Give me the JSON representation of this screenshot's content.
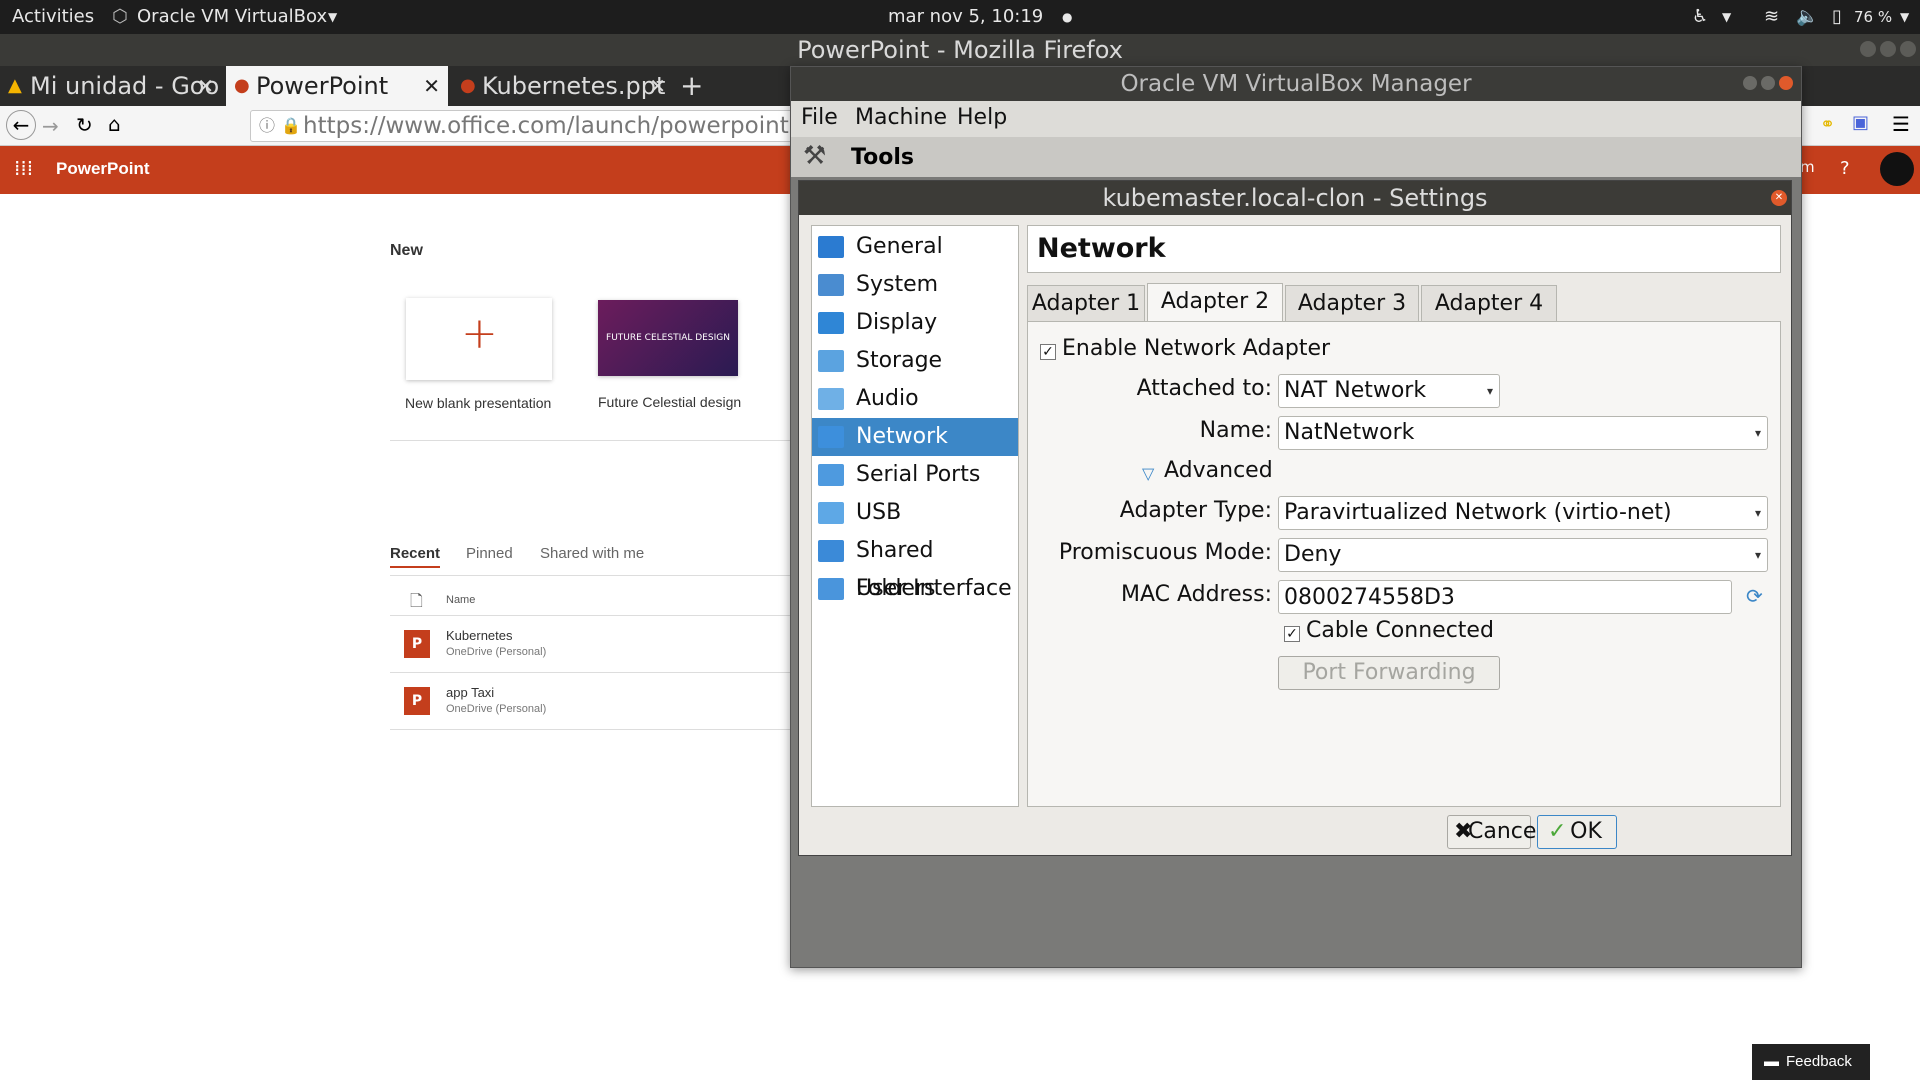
{
  "topbar": {
    "activities": "Activities",
    "app_menu": "Oracle VM VirtualBox",
    "clock": "mar nov  5, 10:19",
    "battery": "76 %"
  },
  "firefox": {
    "window_title": "PowerPoint - Mozilla Firefox",
    "tabs": [
      {
        "label": "Mi unidad - Goo"
      },
      {
        "label": "PowerPoint"
      },
      {
        "label": "Kubernetes.ppt"
      }
    ],
    "url": "https://www.office.com/launch/powerpoint?au"
  },
  "powerpoint": {
    "app_name": "PowerPoint",
    "new_heading": "New",
    "templates": [
      {
        "label": "New blank presentation"
      },
      {
        "label": "Future Celestial design",
        "thumb_text": "FUTURE CELESTIAL DESIGN"
      }
    ],
    "doc_tabs": [
      "Recent",
      "Pinned",
      "Shared with me"
    ],
    "name_header": "Name",
    "files": [
      {
        "name": "Kubernetes",
        "location": "OneDrive (Personal)"
      },
      {
        "name": "app Taxi",
        "location": "OneDrive (Personal)"
      }
    ],
    "feedback": "Feedback",
    "colors": {
      "accent": "#c43e1c"
    }
  },
  "vbox_manager": {
    "title": "Oracle VM VirtualBox Manager",
    "menu": [
      "File",
      "Machine",
      "Help"
    ],
    "tools_label": "Tools"
  },
  "settings": {
    "title": "kubemaster.local-clon - Settings",
    "sections": [
      {
        "label": "General",
        "icon": "general-icon",
        "color": "#2b7bd1"
      },
      {
        "label": "System",
        "icon": "system-icon",
        "color": "#4a8cd0"
      },
      {
        "label": "Display",
        "icon": "display-icon",
        "color": "#2f86d6"
      },
      {
        "label": "Storage",
        "icon": "storage-icon",
        "color": "#5ba3e0"
      },
      {
        "label": "Audio",
        "icon": "audio-icon",
        "color": "#6fb0e6"
      },
      {
        "label": "Network",
        "icon": "network-icon",
        "color": "#3d8fdc"
      },
      {
        "label": "Serial Ports",
        "icon": "serial-ports-icon",
        "color": "#4e9adf"
      },
      {
        "label": "USB",
        "icon": "usb-icon",
        "color": "#5ea8e6"
      },
      {
        "label": "Shared Folders",
        "icon": "shared-folders-icon",
        "color": "#3b8ad8"
      },
      {
        "label": "User Interface",
        "icon": "user-interface-icon",
        "color": "#4a95dc"
      }
    ],
    "selected_section": "Network",
    "page_title": "Network",
    "adapter_tabs": [
      "Adapter 1",
      "Adapter 2",
      "Adapter 3",
      "Adapter 4"
    ],
    "active_adapter": "Adapter 2",
    "enable_adapter_label": "Enable Network Adapter",
    "enable_adapter_checked": true,
    "attached_to_label": "Attached to:",
    "attached_to_value": "NAT Network",
    "name_label": "Name:",
    "name_value": "NatNetwork",
    "advanced_label": "Advanced",
    "adapter_type_label": "Adapter Type:",
    "adapter_type_value": "Paravirtualized Network (virtio-net)",
    "promiscuous_label": "Promiscuous Mode:",
    "promiscuous_value": "Deny",
    "mac_label": "MAC Address:",
    "mac_value": "0800274558D3",
    "cable_label": "Cable Connected",
    "cable_checked": true,
    "port_forwarding_label": "Port Forwarding",
    "cancel_label": "Cancel",
    "ok_label": "OK",
    "selection_color": "#3c87c7"
  }
}
